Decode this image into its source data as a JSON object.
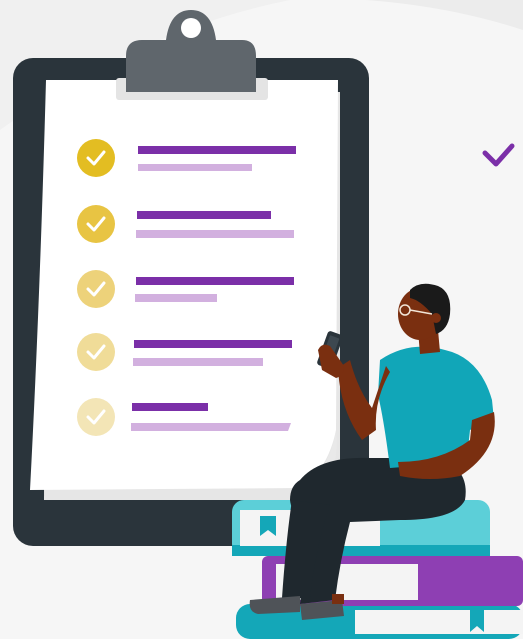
{
  "illustration": {
    "subject": "checklist",
    "colors": {
      "background": "#f6f6f6",
      "background_curve": "#ececec",
      "clipboard_frame": "#2a343b",
      "clip": "#5f666c",
      "paper": "#ffffff",
      "paper_shadow": "#e8e8e8",
      "line_dark": "#7b2fa8",
      "line_light": "#d2b0df",
      "check_accent": "#7b2fa8",
      "skin": "#7a2f10",
      "shirt": "#11a6b8",
      "pants": "#1f282e",
      "hair": "#1a1a1a",
      "book_teal": "#14a7b8",
      "book_teal_light": "#5ccfd8",
      "book_purple": "#8e3fb3",
      "book_pages": "#f4f4f4"
    },
    "checklist": [
      {
        "item": 1,
        "checked": true,
        "check_color": "#e3bd22"
      },
      {
        "item": 2,
        "checked": true,
        "check_color": "#e8c443"
      },
      {
        "item": 3,
        "checked": true,
        "check_color": "#edd27a"
      },
      {
        "item": 4,
        "checked": true,
        "check_color": "#f0dc98"
      },
      {
        "item": 5,
        "checked": true,
        "check_color": "#f3e5b6"
      }
    ],
    "icons": [
      "check-icon",
      "bookmark-icon",
      "phone-icon"
    ]
  }
}
